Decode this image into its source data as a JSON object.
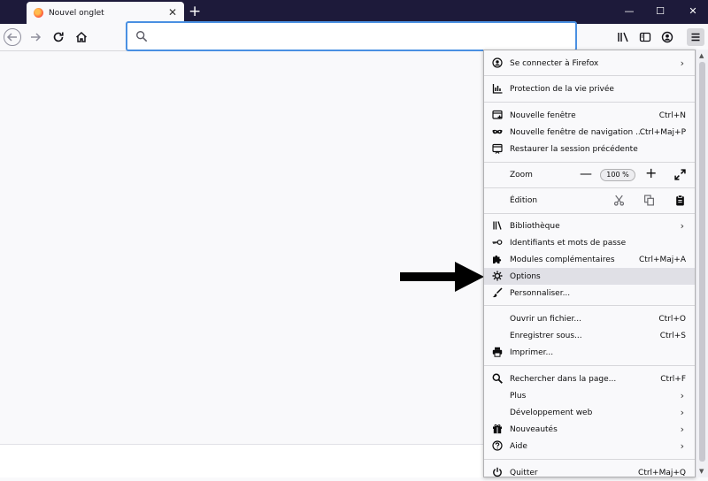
{
  "tab": {
    "title": "Nouvel onglet",
    "close": "✕"
  },
  "titlebar": {
    "new_tab": "+",
    "minimize": "—",
    "maximize": "☐",
    "close": "✕"
  },
  "urlbar": {
    "value": "",
    "placeholder": ""
  },
  "colors": {
    "titlebar": "#1d1a3a",
    "focus_ring": "#4a90e2",
    "menu_bg": "#f9f9fb",
    "highlight": "#e0e0e6"
  },
  "menu": {
    "sign_in": "Se connecter à Firefox",
    "privacy": "Protection de la vie privée",
    "new_window": {
      "label": "Nouvelle fenêtre",
      "shortcut": "Ctrl+N"
    },
    "new_private": {
      "label": "Nouvelle fenêtre de navigation ...",
      "shortcut": "Ctrl+Maj+P"
    },
    "restore_session": "Restaurer la session précédente",
    "zoom": {
      "label": "Zoom",
      "minus": "—",
      "value": "100 %",
      "plus": "+"
    },
    "edit": {
      "label": "Édition"
    },
    "library": "Bibliothèque",
    "logins": "Identifiants et mots de passe",
    "addons": {
      "label": "Modules complémentaires",
      "shortcut": "Ctrl+Maj+A"
    },
    "options": "Options",
    "customize": "Personnaliser...",
    "open_file": {
      "label": "Ouvrir un fichier...",
      "shortcut": "Ctrl+O"
    },
    "save_as": {
      "label": "Enregistrer sous...",
      "shortcut": "Ctrl+S"
    },
    "print": "Imprimer...",
    "find": {
      "label": "Rechercher dans la page...",
      "shortcut": "Ctrl+F"
    },
    "more": "Plus",
    "web_dev": "Développement web",
    "whats_new": "Nouveautés",
    "help": "Aide",
    "quit": {
      "label": "Quitter",
      "shortcut": "Ctrl+Maj+Q"
    },
    "chevron": "›"
  }
}
